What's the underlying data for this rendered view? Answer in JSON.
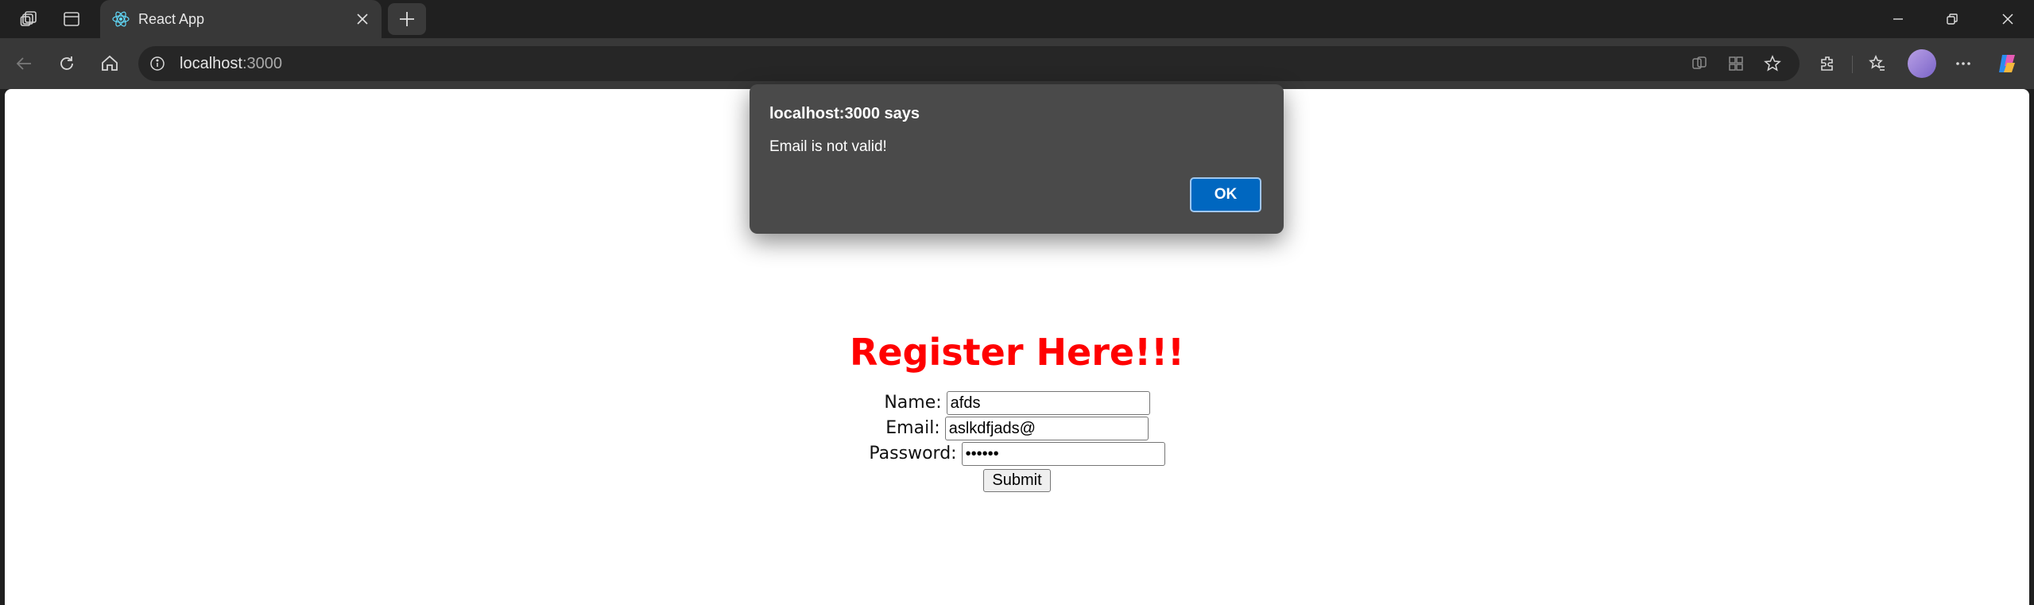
{
  "browser": {
    "tab_title": "React App",
    "url_host": "localhost",
    "url_port": ":3000"
  },
  "page": {
    "heading": "Register Here!!!",
    "fields": {
      "name_label": "Name:",
      "name_value": "afds",
      "email_label": "Email:",
      "email_value": "aslkdfjads@",
      "password_label": "Password:",
      "password_value": "••••••"
    },
    "submit_label": "Submit"
  },
  "alert": {
    "title": "localhost:3000 says",
    "message": "Email is not valid!",
    "ok_label": "OK"
  },
  "colors": {
    "heading": "#ff0000",
    "ok_button": "#0067c0"
  }
}
